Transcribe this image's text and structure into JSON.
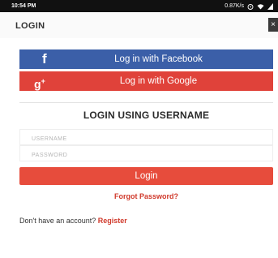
{
  "status_bar": {
    "time": "10:54 PM",
    "network_speed": "0.87K/s"
  },
  "header": {
    "title": "LOGIN",
    "close_label": "×"
  },
  "social": {
    "facebook_label": "Log in with Facebook",
    "facebook_icon": "f",
    "google_label": "Log in with Google",
    "google_icon": "g",
    "google_icon_plus": "+"
  },
  "form": {
    "section_title": "LOGIN USING USERNAME",
    "username_placeholder": "USERNAME",
    "username_value": "",
    "password_placeholder": "PASSWORD",
    "password_value": "",
    "login_label": "Login",
    "forgot_label": "Forgot Password?"
  },
  "footer": {
    "prompt": "Don't have an account? ",
    "register_label": "Register"
  },
  "colors": {
    "facebook": "#3b5fa8",
    "google": "#e0423a",
    "login_button": "#e74c3c",
    "link": "#d0392b"
  }
}
